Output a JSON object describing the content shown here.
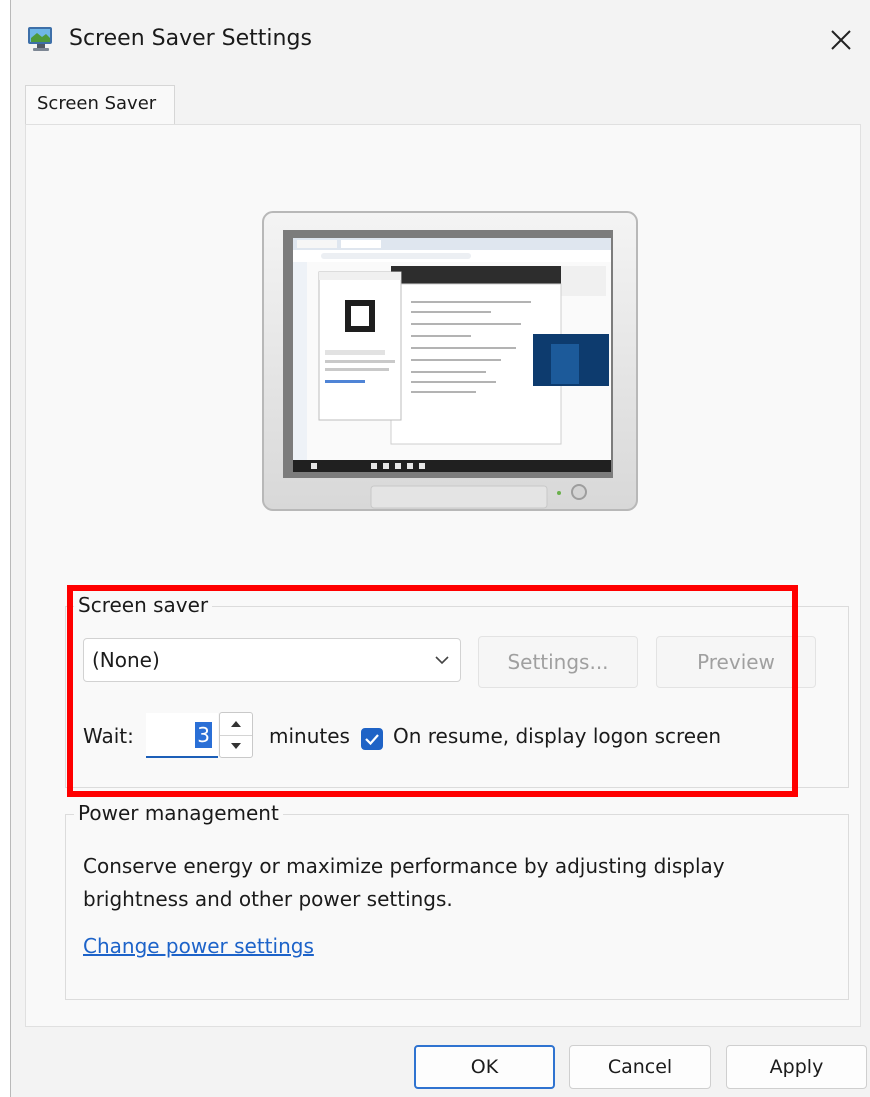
{
  "window": {
    "title": "Screen Saver Settings",
    "app_icon": "monitor-app-icon",
    "close_icon": "close-icon"
  },
  "tabs": [
    {
      "label": "Screen Saver",
      "selected": true
    }
  ],
  "screen_saver": {
    "group_label": "Screen saver",
    "selected": "(None)",
    "settings_label": "Settings...",
    "preview_label": "Preview",
    "wait_label": "Wait:",
    "wait_value": "3",
    "minutes_label": "minutes",
    "logon_checkbox_label": "On resume, display logon screen",
    "logon_checked": true
  },
  "power": {
    "group_label": "Power management",
    "description": "Conserve energy or maximize performance by adjusting display brightness and other power settings.",
    "link": "Change power settings"
  },
  "buttons": {
    "ok": "OK",
    "cancel": "Cancel",
    "apply": "Apply"
  },
  "colors": {
    "highlight": "#ff0000",
    "accent": "#1f63c6",
    "link": "#1d63c9"
  }
}
